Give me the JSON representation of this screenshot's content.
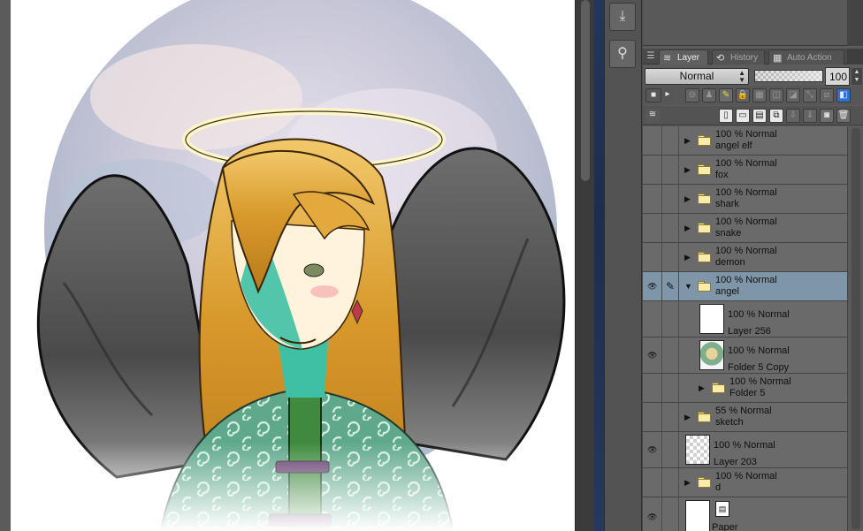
{
  "layer_panel": {
    "tabs": [
      {
        "label": "Layer",
        "icon": "layer-stack-icon"
      },
      {
        "label": "History",
        "icon": "history-icon"
      },
      {
        "label": "Auto Action",
        "icon": "auto-action-icon"
      }
    ],
    "blend_mode": "Normal",
    "opacity": "100",
    "opacity_fraction": 1.0,
    "layers": [
      {
        "mode": "100 % Normal",
        "name": "angel elf",
        "type": "folder",
        "visible": false,
        "expanded": false,
        "selected": false
      },
      {
        "mode": "100 % Normal",
        "name": "fox",
        "type": "folder",
        "visible": false,
        "expanded": false,
        "selected": false
      },
      {
        "mode": "100 % Normal",
        "name": "shark",
        "type": "folder",
        "visible": false,
        "expanded": false,
        "selected": false
      },
      {
        "mode": "100 % Normal",
        "name": "snake",
        "type": "folder",
        "visible": false,
        "expanded": false,
        "selected": false
      },
      {
        "mode": "100 % Normal",
        "name": "demon",
        "type": "folder",
        "visible": false,
        "expanded": false,
        "selected": false
      },
      {
        "mode": "100 % Normal",
        "name": "angel",
        "type": "folder",
        "visible": true,
        "expanded": true,
        "selected": true
      },
      {
        "mode": "100 % Normal",
        "name": "Layer 256",
        "type": "raster",
        "visible": false,
        "selected": false
      },
      {
        "mode": "100 % Normal",
        "name": "Folder 5 Copy",
        "type": "raster",
        "visible": true,
        "selected": false
      },
      {
        "mode": "100 % Normal",
        "name": "Folder 5",
        "type": "folder",
        "visible": false,
        "expanded": false,
        "selected": false
      },
      {
        "mode": "55 % Normal",
        "name": "sketch",
        "type": "folder",
        "visible": false,
        "expanded": false,
        "selected": false
      },
      {
        "mode": "100 % Normal",
        "name": "Layer 203",
        "type": "raster",
        "visible": true,
        "selected": false
      },
      {
        "mode": "100 % Normal",
        "name": "d",
        "type": "folder",
        "visible": false,
        "expanded": false,
        "selected": false
      },
      {
        "mode": "",
        "name": "Paper",
        "type": "paper",
        "visible": true,
        "selected": false
      }
    ]
  },
  "colors": {
    "selected_row": "#7f96a8",
    "row": "#6a6a6a",
    "panel_bg": "#5c5c5c",
    "folder_fill": "#f7ecaa"
  }
}
